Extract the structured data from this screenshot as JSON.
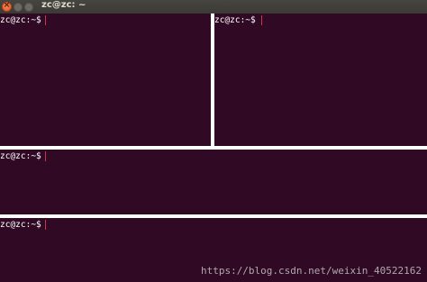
{
  "window": {
    "title": "zc@zc: ~",
    "close_glyph": "×"
  },
  "panes": [
    {
      "prompt": "zc@zc:~$"
    },
    {
      "prompt": "zc@zc:~$"
    },
    {
      "prompt": "zc@zc:~$"
    },
    {
      "prompt": "zc@zc:~$"
    }
  ],
  "watermark": "https://blog.csdn.net/weixin_40522162",
  "colors": {
    "terminal_background": "#300a24",
    "prompt_text": "#ffffff",
    "cursor": "#cc3344",
    "divider": "#ffffff"
  }
}
